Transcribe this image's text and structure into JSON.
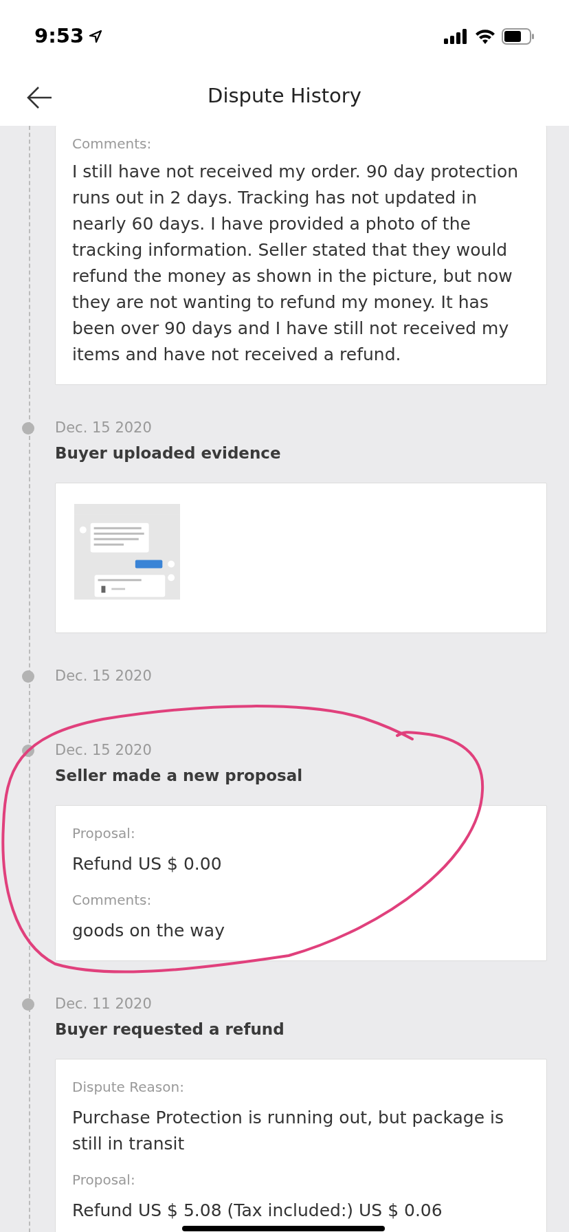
{
  "status_bar": {
    "time": "9:53"
  },
  "header": {
    "title": "Dispute History"
  },
  "timeline": [
    {
      "card": {
        "kind": "fields",
        "fields": [
          {
            "label": "Comments:",
            "value": "I still have not received my order. 90 day protection runs out in 2 days. Tracking has not updated in nearly 60 days. I have provided a photo of the tracking information. Seller stated that they would refund the money as shown in the picture, but now they are not wanting to refund my money. It has been over 90 days and I have still not received my items and have not received a refund."
          }
        ]
      }
    },
    {
      "date": "Dec. 15 2020",
      "title": "Buyer uploaded evidence",
      "card": {
        "kind": "evidence"
      }
    },
    {
      "date": "Dec. 15 2020"
    },
    {
      "date": "Dec. 15 2020",
      "title": "Seller made a new proposal",
      "card": {
        "kind": "fields",
        "fields": [
          {
            "label": "Proposal:",
            "value": "Refund US $ 0.00"
          },
          {
            "label": "Comments:",
            "value": "goods on the way"
          }
        ]
      }
    },
    {
      "date": "Dec. 11 2020",
      "title": "Buyer requested a refund",
      "card": {
        "kind": "fields",
        "fields": [
          {
            "label": "Dispute Reason:",
            "value": "Purchase Protection is running out, but package is still in transit"
          },
          {
            "label": "Proposal:",
            "value": "Refund US $ 5.08 (Tax included:) US $ 0.06"
          }
        ]
      }
    }
  ]
}
